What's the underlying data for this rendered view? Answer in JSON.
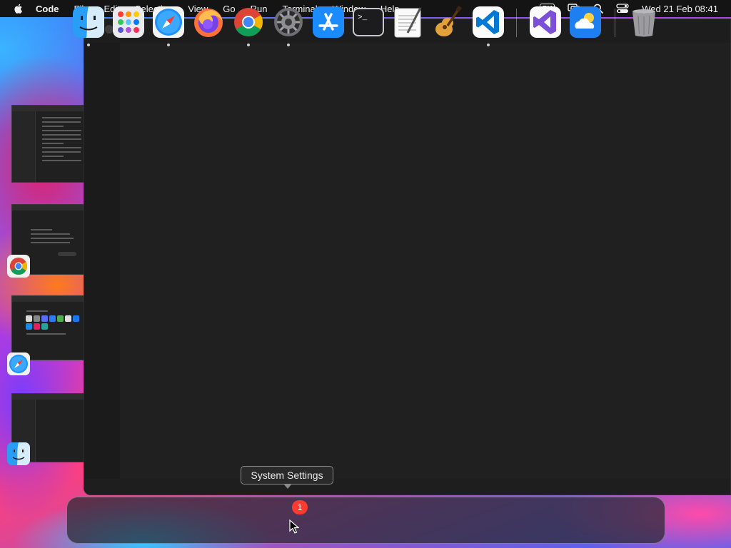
{
  "menubar": {
    "app_name": "Code",
    "items": [
      "File",
      "Edit",
      "Selection",
      "View",
      "Go",
      "Run",
      "Terminal",
      "Window",
      "Help"
    ],
    "input_source": "PY",
    "clock": "Wed 21 Feb  08:41"
  },
  "tooltip": {
    "text": "System Settings"
  },
  "dock": {
    "settings_badge": "1",
    "apps": [
      "finder",
      "launchpad",
      "safari",
      "firefox",
      "chrome",
      "system-settings",
      "app-store",
      "terminal",
      "textedit",
      "garageband",
      "vscode",
      "visual-studio",
      "weather",
      "trash"
    ]
  },
  "colors": {
    "menubar_bg": "#141414",
    "window_bg": "#1e1e1e",
    "badge": "#ff3b30",
    "vscode_blue": "#0078d4"
  }
}
